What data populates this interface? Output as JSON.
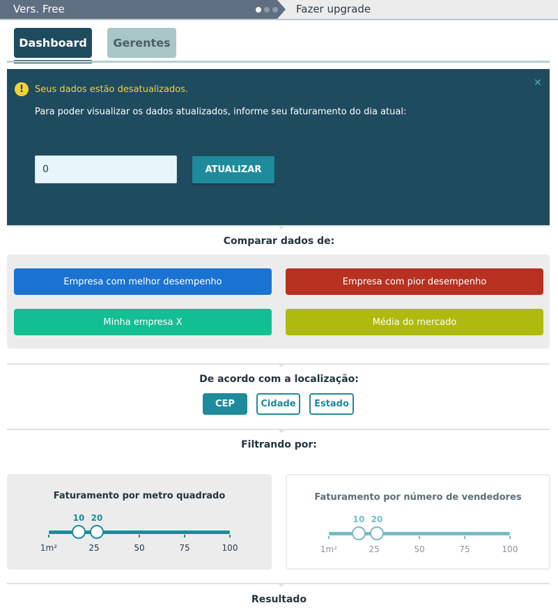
{
  "topbar": {
    "version_label": "Vers. Free",
    "upgrade_label": "Fazer upgrade",
    "colors": {
      "left_bg": "#5f6f82",
      "right_bg": "#ececec"
    }
  },
  "tabs": [
    {
      "label": "Dashboard",
      "active": true
    },
    {
      "label": "Gerentes",
      "active": false
    }
  ],
  "alert": {
    "icon": "warning-icon",
    "title": "Seus dados estão desatualizados.",
    "message": "Para poder visualizar os dados atualizados, informe seu faturamento do dia atual:",
    "input_value": "0",
    "button_label": "ATUALIZAR",
    "close_icon": "close-icon",
    "colors": {
      "bg": "#1f4b5e",
      "title": "#f2d23a",
      "button": "#1d8b9b"
    }
  },
  "compare": {
    "title": "Comparar dados de:",
    "buttons": [
      {
        "label": "Empresa com melhor desempenho",
        "color": "#1a73d0"
      },
      {
        "label": "Empresa com pior desempenho",
        "color": "#b73121"
      },
      {
        "label": "Minha empresa X",
        "color": "#13bf92"
      },
      {
        "label": "Média do mercado",
        "color": "#aebb0e"
      }
    ]
  },
  "location": {
    "title": "De acordo com a localização:",
    "options": [
      {
        "label": "CEP",
        "active": true
      },
      {
        "label": "Cidade",
        "active": false
      },
      {
        "label": "Estado",
        "active": false
      }
    ]
  },
  "filters": {
    "title": "Filtrando por:",
    "panels": [
      {
        "title": "Faturamento por metro quadrado",
        "min_value": "10",
        "max_value": "20",
        "range_min": 0,
        "range_max": 100,
        "ticks": [
          "1m²",
          "25",
          "50",
          "75",
          "100"
        ],
        "color": "#1d8b9b",
        "active": true
      },
      {
        "title": "Faturamento por número de vendedores",
        "min_value": "10",
        "max_value": "20",
        "range_min": 0,
        "range_max": 100,
        "ticks": [
          "1m²",
          "25",
          "50",
          "75",
          "100"
        ],
        "color": "#79bac6",
        "active": false
      }
    ]
  },
  "result": {
    "title": "Resultado"
  }
}
